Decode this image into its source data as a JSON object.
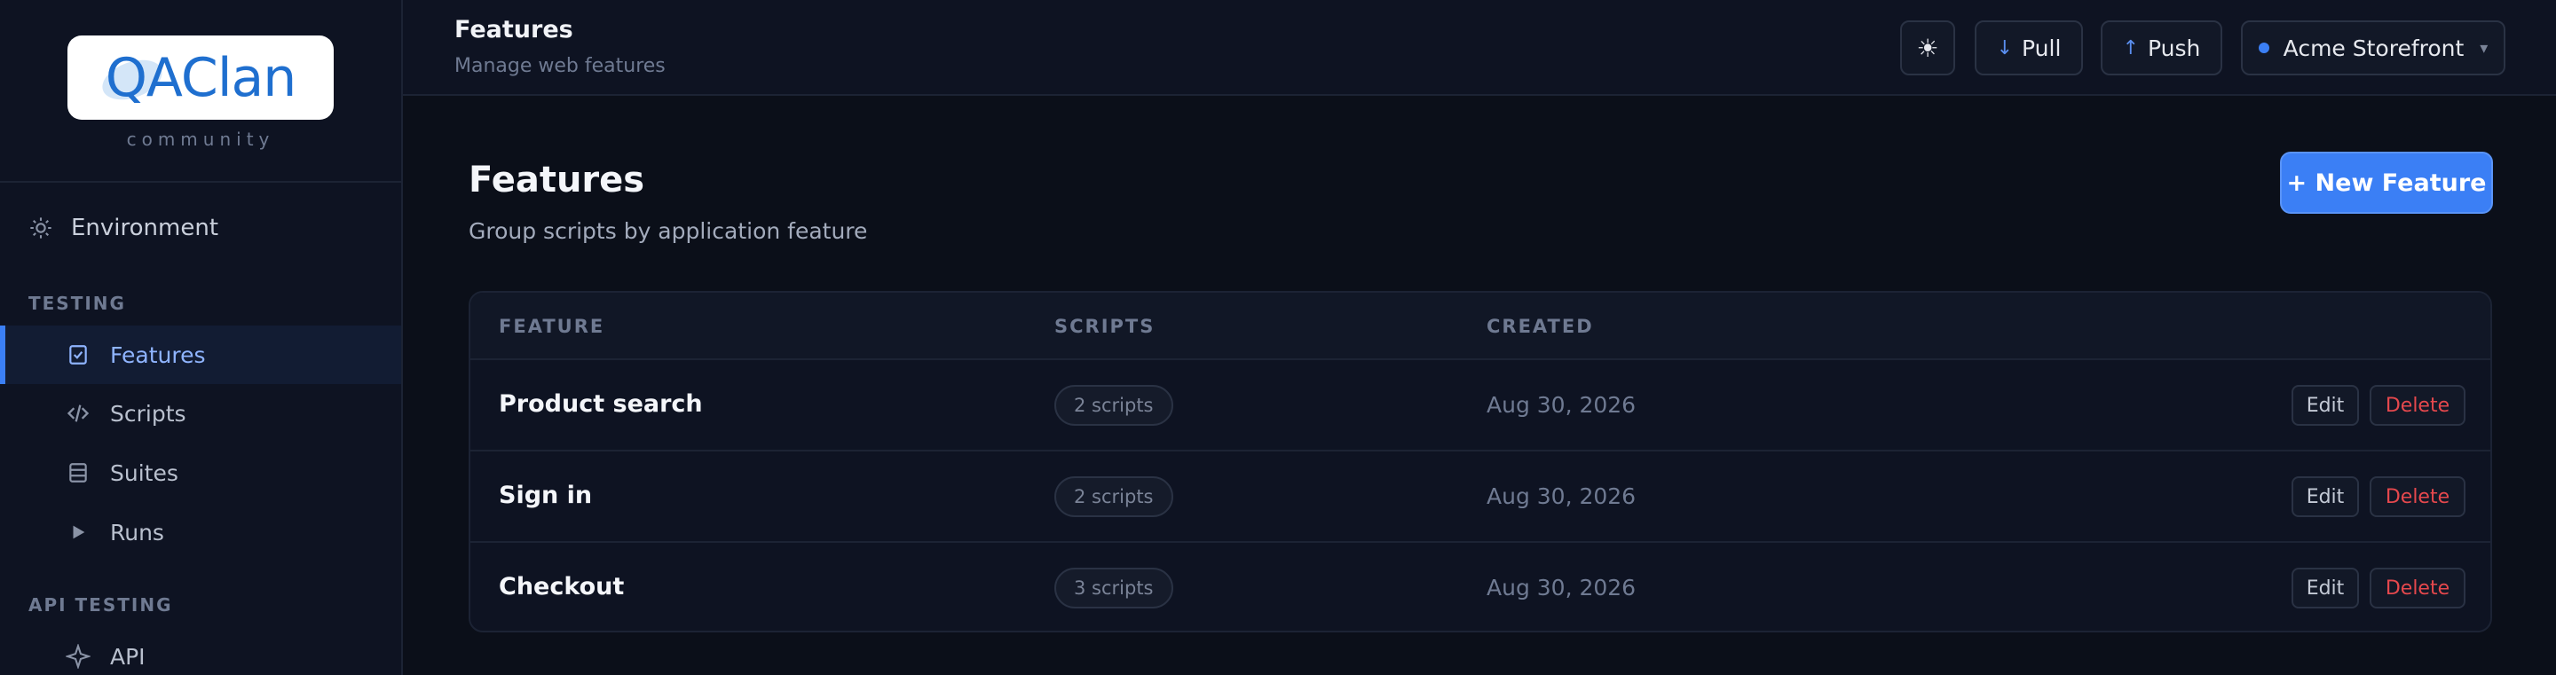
{
  "brand": {
    "logo_text": "QAClan",
    "tagline": "community"
  },
  "sidebar": {
    "environment_label": "Environment",
    "sections": [
      {
        "label": "TESTING"
      },
      {
        "label": "API TESTING"
      }
    ],
    "items": [
      {
        "label": "Features",
        "icon": "checklist-icon",
        "active": true
      },
      {
        "label": "Scripts",
        "icon": "code-icon"
      },
      {
        "label": "Suites",
        "icon": "stack-icon"
      },
      {
        "label": "Runs",
        "icon": "play-icon"
      },
      {
        "label": "API",
        "icon": "sparkle-icon"
      }
    ]
  },
  "header": {
    "title": "Features",
    "subtitle": "Manage web features",
    "theme_icon": "sun-icon",
    "pull_label": "Pull",
    "push_label": "Push",
    "project_label": "Acme Storefront"
  },
  "main": {
    "title": "Features",
    "subtitle": "Group scripts by application feature",
    "new_button": "+ New Feature",
    "columns": [
      "FEATURE",
      "SCRIPTS",
      "CREATED"
    ],
    "rows": [
      {
        "name": "Product search",
        "scripts": "2 scripts",
        "created": "Aug 30, 2026",
        "edit": "Edit",
        "delete": "Delete"
      },
      {
        "name": "Sign in",
        "scripts": "2 scripts",
        "created": "Aug 30, 2026",
        "edit": "Edit",
        "delete": "Delete"
      },
      {
        "name": "Checkout",
        "scripts": "3 scripts",
        "created": "Aug 30, 2026",
        "edit": "Edit",
        "delete": "Delete"
      }
    ]
  },
  "colors": {
    "accent": "#3b7ff5",
    "danger": "#e5484d",
    "background": "#0b0f19"
  }
}
